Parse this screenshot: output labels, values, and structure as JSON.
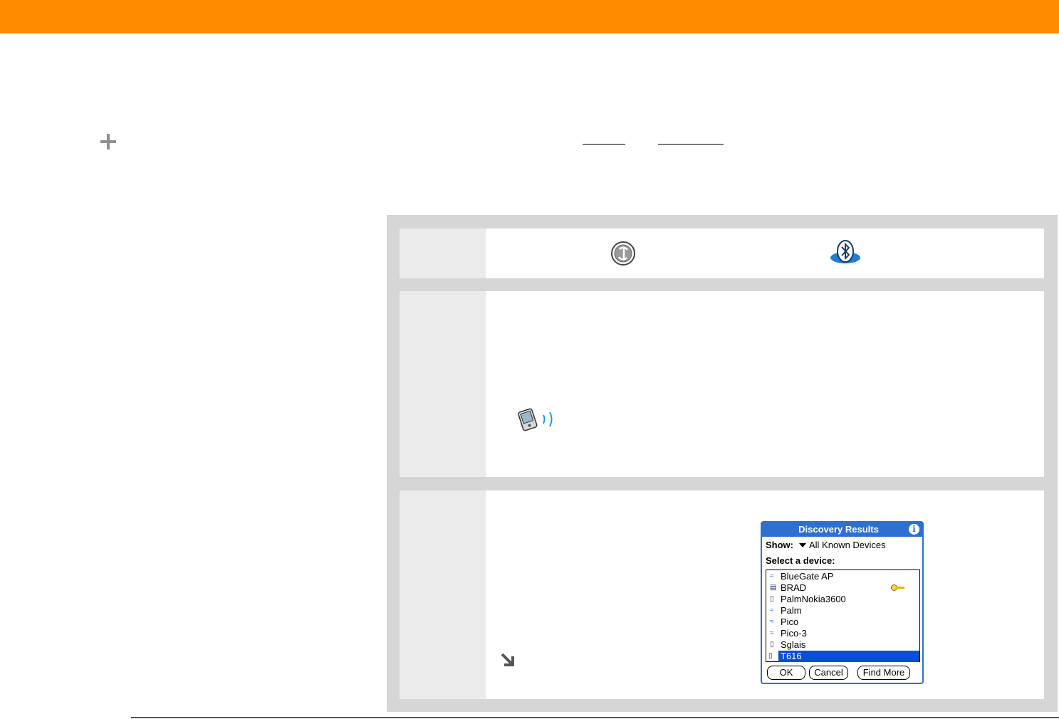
{
  "dialog": {
    "title": "Discovery Results",
    "show_label": "Show:",
    "show_value": "All Known Devices",
    "select_label": "Select a device:",
    "devices": [
      {
        "name": "BlueGate AP",
        "icon": "access-point-icon"
      },
      {
        "name": "BRAD",
        "icon": "computer-icon",
        "badge": "key-icon"
      },
      {
        "name": "PalmNokia3600",
        "icon": "phone-icon"
      },
      {
        "name": "Palm",
        "icon": "access-point-icon"
      },
      {
        "name": "Pico",
        "icon": "access-point-icon"
      },
      {
        "name": "Pico-3",
        "icon": "access-point-icon"
      },
      {
        "name": "Sglais",
        "icon": "phone-icon"
      },
      {
        "name": "T616",
        "icon": "phone-icon",
        "selected": true
      }
    ],
    "buttons": {
      "ok": "OK",
      "cancel": "Cancel",
      "find_more": "Find More"
    }
  },
  "colors": {
    "header_orange": "#ff8c00",
    "panel_gray": "#d6d6d6",
    "palm_blue": "#2e6fcf",
    "selection_blue": "#0a4ed6",
    "link_blue": "#1a9be0"
  }
}
